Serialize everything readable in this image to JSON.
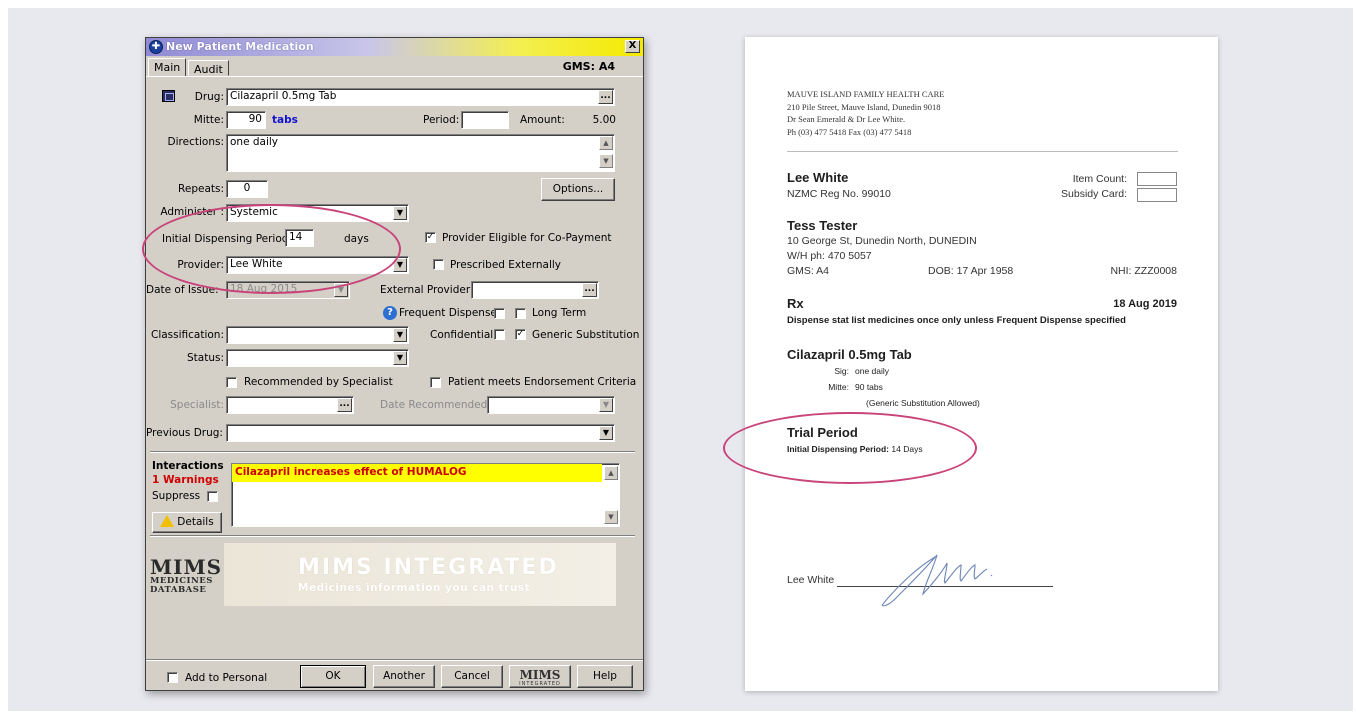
{
  "dialog": {
    "title": "New Patient Medication",
    "close_label": "X",
    "tabs": [
      "Main",
      "Audit"
    ],
    "gms": "GMS: A4",
    "drug_label": "Drug:",
    "drug_value": "Cilazapril 0.5mg Tab",
    "mitte_label": "Mitte:",
    "mitte_value": "90",
    "mitte_unit": "tabs",
    "period_label": "Period:",
    "period_value": "",
    "amount_label": "Amount:",
    "amount_value": "5.00",
    "directions_label": "Directions:",
    "directions_value": "one daily",
    "repeats_label": "Repeats:",
    "repeats_value": "0",
    "options_label": "Options...",
    "administer_label": "Administer :",
    "administer_value": "Systemic",
    "idp_label": "Initial Dispensing Period:",
    "idp_value": "14",
    "idp_unit": "days",
    "provider_eligible_label": "Provider Eligible for Co-Payment",
    "provider_eligible_checked": true,
    "provider_label": "Provider:",
    "provider_value": "Lee White",
    "prescribed_externally_label": "Prescribed Externally",
    "prescribed_externally_checked": false,
    "date_of_issue_label": "Date of Issue:",
    "date_of_issue_value": "18 Aug 2015",
    "external_provider_label": "External Provider:",
    "external_provider_value": "",
    "frequent_dispense_label": "Frequent Dispense",
    "frequent_dispense_checked": false,
    "long_term_label": "Long Term",
    "long_term_checked": false,
    "classification_label": "Classification:",
    "classification_value": "",
    "confidential_label": "Confidential",
    "confidential_checked": false,
    "generic_substitution_label": "Generic Substitution",
    "generic_substitution_checked": true,
    "status_label": "Status:",
    "status_value": "",
    "recommended_label": "Recommended by Specialist",
    "recommended_checked": false,
    "endorsement_label": "Patient meets Endorsement Criteria",
    "endorsement_checked": false,
    "specialist_label": "Specialist:",
    "specialist_value": "",
    "date_recommended_label": "Date Recommended:",
    "date_recommended_value": "",
    "previous_drug_label": "Previous Drug:",
    "previous_drug_value": "",
    "interactions_label": "Interactions",
    "warnings_label": "1 Warnings",
    "suppress_label": "Suppress",
    "suppress_checked": false,
    "details_label": "Details",
    "interaction_text": "Cilazapril increases effect of HUMALOG",
    "mims_logo_big": "MIMS",
    "mims_logo_line1": "MEDICINES",
    "mims_logo_line2": "DATABASE",
    "banner_title": "MIMS INTEGRATED",
    "banner_subtitle": "Medicines information you can trust",
    "add_to_personal_label": "Add to Personal",
    "add_to_personal_checked": false,
    "ok_label": "OK",
    "another_label": "Another",
    "cancel_label": "Cancel",
    "mims_button_label": "MIMS",
    "mims_button_sub": "INTEGRATED",
    "help_label": "Help"
  },
  "prescription": {
    "clinic_name": "MAUVE ISLAND FAMILY HEALTH CARE",
    "clinic_address": "210 Pile Street, Mauve Island, Dunedin 9018",
    "clinic_doctors": "Dr Sean Emerald & Dr Lee White.",
    "clinic_phone": "Ph (03) 477 5418 Fax (03) 477 5418",
    "prescriber_name": "Lee White",
    "prescriber_reg": "NZMC Reg No. 99010",
    "item_count_label": "Item Count:",
    "subsidy_card_label": "Subsidy Card:",
    "patient_name": "Tess Tester",
    "patient_address": "10 George St, Dunedin North, DUNEDIN",
    "patient_phone": "W/H ph: 470 5057",
    "patient_gms": "GMS: A4",
    "patient_dob": "DOB: 17 Apr 1958",
    "patient_nhi": "NHI: ZZZ0008",
    "rx_label": "Rx",
    "rx_date": "18 Aug 2019",
    "rx_note": "Dispense stat list medicines once only unless Frequent Dispense specified",
    "drug_name": "Cilazapril 0.5mg Tab",
    "sig_label": "Sig:",
    "sig_value": "one daily",
    "mitte_label": "Mitte:",
    "mitte_value": "90 tabs",
    "generic_note": "(Generic Substitution Allowed)",
    "trial_title": "Trial Period",
    "idp_label": "Initial Dispensing Period:",
    "idp_value": "14 Days",
    "signature_name": "Lee White"
  },
  "colors": {
    "highlight_ellipse": "#c8447a",
    "interaction_bg": "#ffff00",
    "interaction_text": "#cc0000",
    "mitte_unit": "#1010d0",
    "background": "#e8e9ee"
  }
}
